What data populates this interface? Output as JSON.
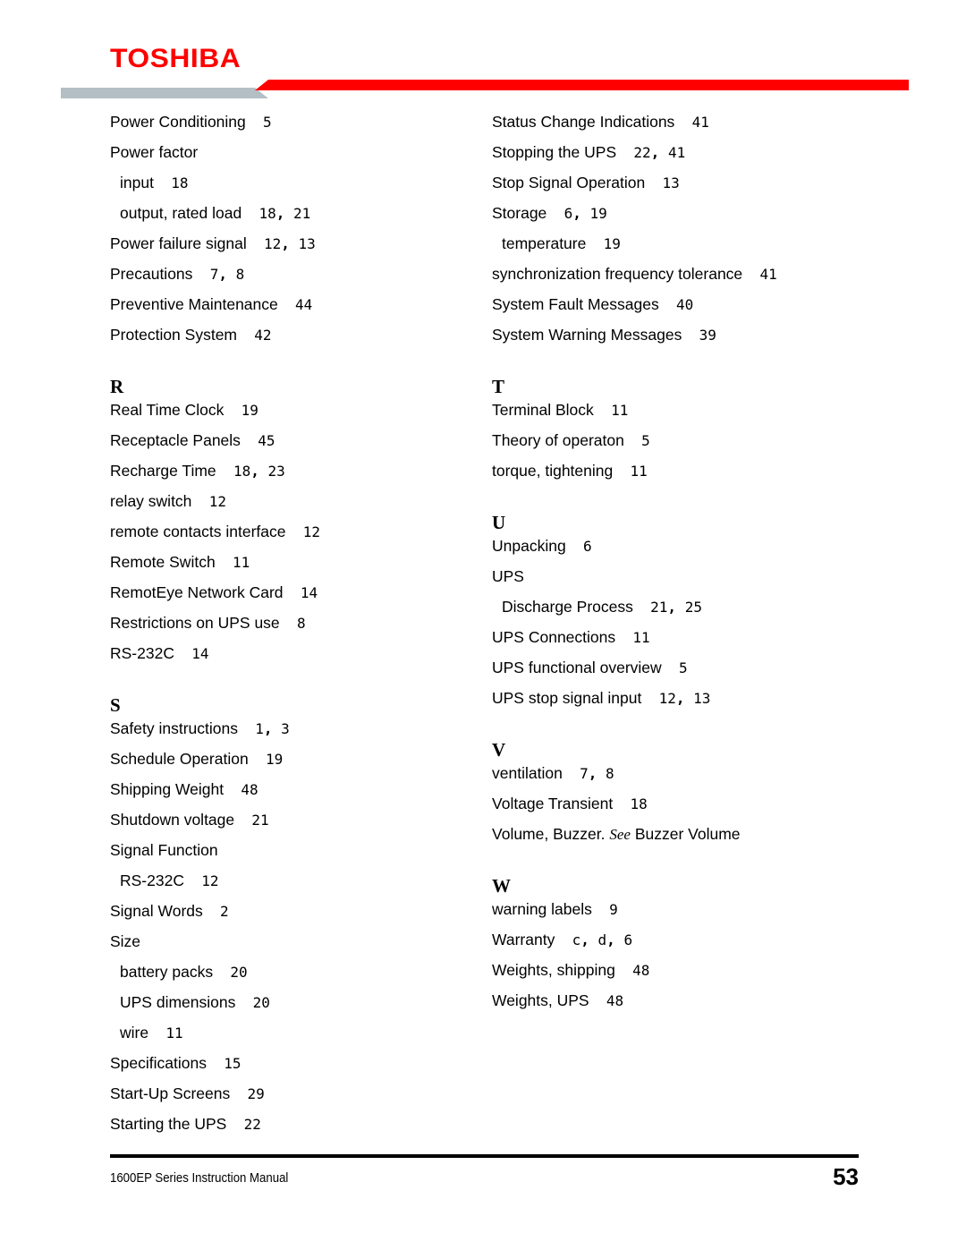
{
  "header": {
    "brand": "TOSHIBA",
    "brand_color": "#ff0000",
    "rule_gray": "#b4bfc4",
    "rule_red": "#ff0000"
  },
  "index": {
    "columns": [
      {
        "name": "left-column",
        "blocks": [
          {
            "type": "entries",
            "entries": [
              {
                "label": "Power Conditioning",
                "pages": "5",
                "sub": false
              },
              {
                "label": "Power factor",
                "pages": "",
                "sub": false
              },
              {
                "label": "input",
                "pages": "18",
                "sub": true
              },
              {
                "label": "output, rated load",
                "pages": "18, 21",
                "sub": true
              },
              {
                "label": "Power failure signal",
                "pages": "12, 13",
                "sub": false
              },
              {
                "label": "Precautions",
                "pages": "7, 8",
                "sub": false
              },
              {
                "label": "Preventive Maintenance",
                "pages": "44",
                "sub": false
              },
              {
                "label": "Protection System",
                "pages": "42",
                "sub": false
              }
            ]
          },
          {
            "type": "section",
            "heading": "R",
            "entries": [
              {
                "label": "Real Time Clock",
                "pages": "19",
                "sub": false
              },
              {
                "label": "Receptacle Panels",
                "pages": "45",
                "sub": false
              },
              {
                "label": "Recharge Time",
                "pages": "18, 23",
                "sub": false
              },
              {
                "label": "relay switch",
                "pages": "12",
                "sub": false
              },
              {
                "label": "remote contacts interface",
                "pages": "12",
                "sub": false
              },
              {
                "label": "Remote Switch",
                "pages": "11",
                "sub": false
              },
              {
                "label": "RemotEye Network Card",
                "pages": "14",
                "sub": false
              },
              {
                "label": "Restrictions on UPS use",
                "pages": "8",
                "sub": false
              },
              {
                "label": "RS-232C",
                "pages": "14",
                "sub": false
              }
            ]
          },
          {
            "type": "section",
            "heading": "S",
            "entries": [
              {
                "label": "Safety instructions",
                "pages": "1, 3",
                "sub": false
              },
              {
                "label": "Schedule Operation",
                "pages": "19",
                "sub": false
              },
              {
                "label": "Shipping Weight",
                "pages": "48",
                "sub": false
              },
              {
                "label": "Shutdown voltage",
                "pages": "21",
                "sub": false
              },
              {
                "label": "Signal Function",
                "pages": "",
                "sub": false
              },
              {
                "label": "RS-232C",
                "pages": "12",
                "sub": true
              },
              {
                "label": "Signal Words",
                "pages": "2",
                "sub": false
              },
              {
                "label": "Size",
                "pages": "",
                "sub": false
              },
              {
                "label": "battery packs",
                "pages": "20",
                "sub": true
              },
              {
                "label": "UPS dimensions",
                "pages": "20",
                "sub": true
              },
              {
                "label": "wire",
                "pages": "11",
                "sub": true
              },
              {
                "label": "Specifications",
                "pages": "15",
                "sub": false
              },
              {
                "label": "Start-Up Screens",
                "pages": "29",
                "sub": false
              },
              {
                "label": "Starting the UPS",
                "pages": "22",
                "sub": false
              }
            ]
          }
        ]
      },
      {
        "name": "right-column",
        "blocks": [
          {
            "type": "entries",
            "entries": [
              {
                "label": "Status Change Indications",
                "pages": "41",
                "sub": false
              },
              {
                "label": "Stopping the UPS",
                "pages": "22, 41",
                "sub": false
              },
              {
                "label": "Stop Signal Operation",
                "pages": "13",
                "sub": false
              },
              {
                "label": "Storage",
                "pages": "6, 19",
                "sub": false
              },
              {
                "label": "temperature",
                "pages": "19",
                "sub": true
              },
              {
                "label": "synchronization frequency tolerance",
                "pages": "41",
                "sub": false
              },
              {
                "label": "System Fault Messages",
                "pages": "40",
                "sub": false
              },
              {
                "label": "System Warning Messages",
                "pages": "39",
                "sub": false
              }
            ]
          },
          {
            "type": "section",
            "heading": "T",
            "entries": [
              {
                "label": "Terminal Block",
                "pages": "11",
                "sub": false
              },
              {
                "label": "Theory of operaton",
                "pages": "5",
                "sub": false
              },
              {
                "label": "torque, tightening",
                "pages": "11",
                "sub": false
              }
            ]
          },
          {
            "type": "section",
            "heading": "U",
            "entries": [
              {
                "label": "Unpacking",
                "pages": "6",
                "sub": false
              },
              {
                "label": "UPS",
                "pages": "",
                "sub": false
              },
              {
                "label": "Discharge Process",
                "pages": "21, 25",
                "sub": true
              },
              {
                "label": "UPS Connections",
                "pages": "11",
                "sub": false
              },
              {
                "label": "UPS functional overview",
                "pages": "5",
                "sub": false
              },
              {
                "label": "UPS stop signal input",
                "pages": "12, 13",
                "sub": false
              }
            ]
          },
          {
            "type": "section",
            "heading": "V",
            "entries": [
              {
                "label": "ventilation",
                "pages": "7, 8",
                "sub": false
              },
              {
                "label": "Voltage Transient",
                "pages": "18",
                "sub": false
              },
              {
                "label": "Volume, Buzzer.",
                "pages": "",
                "see": "See",
                "see_target": "Buzzer Volume",
                "sub": false
              }
            ]
          },
          {
            "type": "section",
            "heading": "W",
            "entries": [
              {
                "label": "warning labels",
                "pages": "9",
                "sub": false
              },
              {
                "label": "Warranty",
                "pages": "c, d, 6",
                "sub": false
              },
              {
                "label": "Weights, shipping",
                "pages": "48",
                "sub": false
              },
              {
                "label": "Weights, UPS",
                "pages": "48",
                "sub": false
              }
            ]
          }
        ]
      }
    ]
  },
  "footer": {
    "manual_title": "1600EP Series Instruction Manual",
    "page_number": "53"
  }
}
